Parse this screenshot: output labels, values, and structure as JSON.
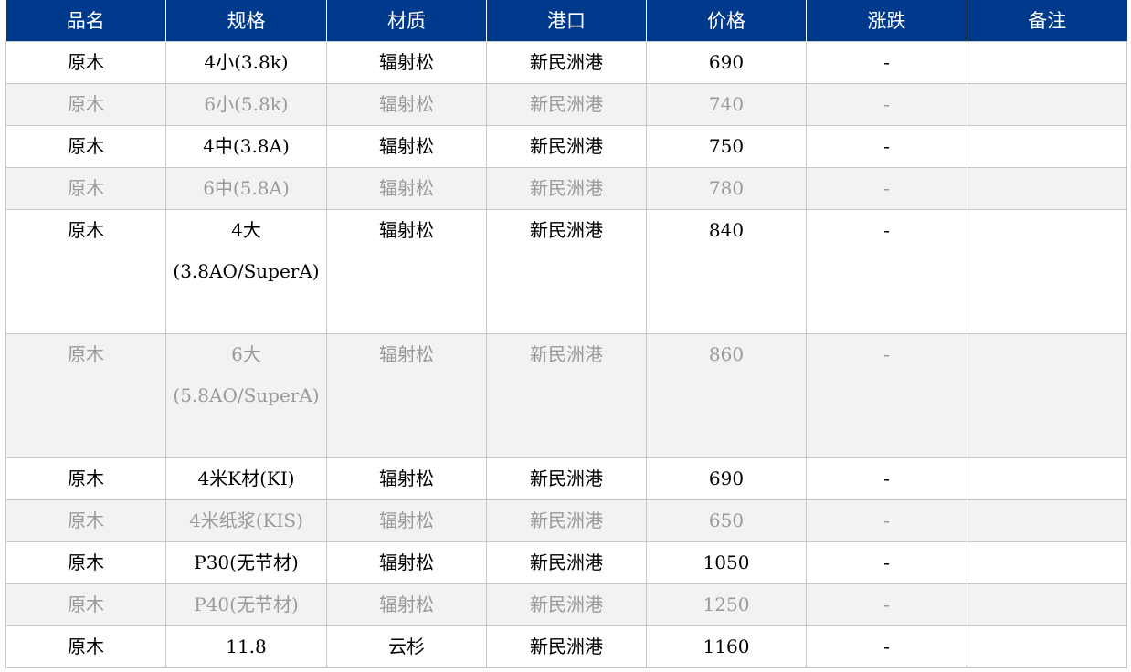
{
  "table": {
    "headers": [
      "品名",
      "规格",
      "材质",
      "港口",
      "价格",
      "涨跌",
      "备注"
    ],
    "rows": [
      {
        "name": "原木",
        "spec": "4小(3.8k)",
        "material": "辐射松",
        "port": "新民洲港",
        "price": "690",
        "change": "-",
        "note": ""
      },
      {
        "name": "原木",
        "spec": "6小(5.8k)",
        "material": "辐射松",
        "port": "新民洲港",
        "price": "740",
        "change": "-",
        "note": ""
      },
      {
        "name": "原木",
        "spec": "4中(3.8A)",
        "material": "辐射松",
        "port": "新民洲港",
        "price": "750",
        "change": "-",
        "note": ""
      },
      {
        "name": "原木",
        "spec": "6中(5.8A)",
        "material": "辐射松",
        "port": "新民洲港",
        "price": "780",
        "change": "-",
        "note": ""
      },
      {
        "name": "原木",
        "spec": "4大(3.8AO/SuperA)",
        "material": "辐射松",
        "port": "新民洲港",
        "price": "840",
        "change": "-",
        "note": ""
      },
      {
        "name": "原木",
        "spec": "6大(5.8AO/SuperA)",
        "material": "辐射松",
        "port": "新民洲港",
        "price": "860",
        "change": "-",
        "note": ""
      },
      {
        "name": "原木",
        "spec": "4米K材(KI)",
        "material": "辐射松",
        "port": "新民洲港",
        "price": "690",
        "change": "-",
        "note": ""
      },
      {
        "name": "原木",
        "spec": "4米纸浆(KIS)",
        "material": "辐射松",
        "port": "新民洲港",
        "price": "650",
        "change": "-",
        "note": ""
      },
      {
        "name": "原木",
        "spec": "P30(无节材)",
        "material": "辐射松",
        "port": "新民洲港",
        "price": "1050",
        "change": "-",
        "note": ""
      },
      {
        "name": "原木",
        "spec": "P40(无节材)",
        "material": "辐射松",
        "port": "新民洲港",
        "price": "1250",
        "change": "-",
        "note": ""
      },
      {
        "name": "原木",
        "spec": "11.8",
        "material": "云杉",
        "port": "新民洲港",
        "price": "1160",
        "change": "-",
        "note": ""
      }
    ]
  }
}
